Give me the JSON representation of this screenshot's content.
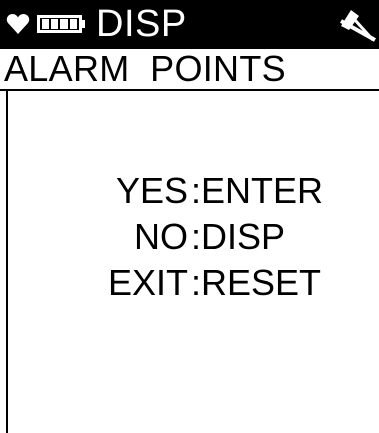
{
  "header": {
    "title": "DISP",
    "icons": {
      "heart": "heart-icon",
      "battery": "battery-icon",
      "signal": "antenna-icon"
    }
  },
  "subheader": {
    "label": "ALARM  POINTS"
  },
  "menu": {
    "items": [
      {
        "key": "YES",
        "value": ":ENTER"
      },
      {
        "key": "NO",
        "value": ":DISP"
      },
      {
        "key": "EXIT",
        "value": ":RESET"
      }
    ]
  },
  "colors": {
    "background": "#ffffff",
    "foreground": "#000000",
    "header_bg": "#000000",
    "header_fg": "#ffffff"
  }
}
